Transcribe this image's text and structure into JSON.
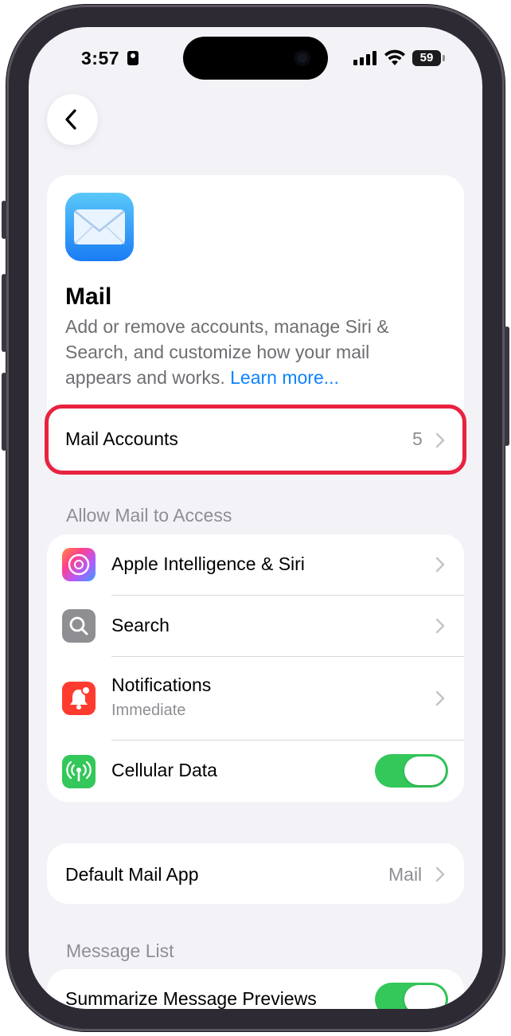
{
  "status_bar": {
    "time": "3:57",
    "battery_level": "59"
  },
  "header": {
    "back_icon": "chevron-left-icon"
  },
  "app_card": {
    "icon": "mail-app-icon",
    "title": "Mail",
    "description": "Add or remove accounts, manage Siri & Search, and customize how your mail appears and works.",
    "learn_more": "Learn more..."
  },
  "mail_accounts": {
    "label": "Mail Accounts",
    "count": "5",
    "highlight_color": "#e8223f"
  },
  "access_section": {
    "header": "Allow Mail to Access",
    "items": [
      {
        "label": "Apple Intelligence & Siri",
        "icon": "apple-intelligence-icon"
      },
      {
        "label": "Search",
        "icon": "search-icon"
      },
      {
        "label": "Notifications",
        "sublabel": "Immediate",
        "icon": "notifications-icon"
      },
      {
        "label": "Cellular Data",
        "icon": "cellular-data-icon",
        "toggle": "on"
      }
    ]
  },
  "default_app": {
    "label": "Default Mail App",
    "value": "Mail"
  },
  "message_list": {
    "header": "Message List",
    "items": [
      {
        "label": "Summarize Message Previews",
        "toggle": "on"
      }
    ]
  },
  "colors": {
    "accent": "#0a84ff",
    "toggle_on": "#34c759",
    "background": "#f2f2f7"
  }
}
